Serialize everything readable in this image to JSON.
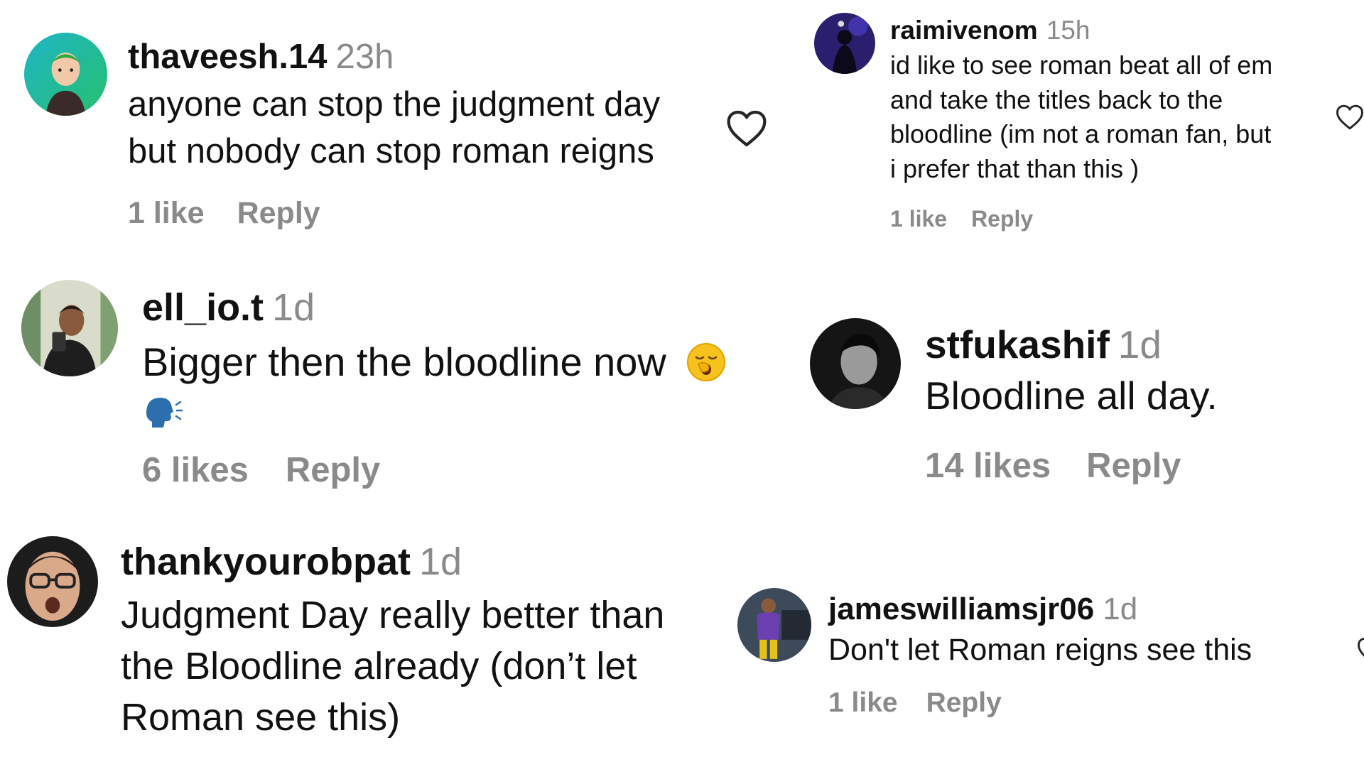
{
  "comments": [
    {
      "username": "thaveesh.14",
      "time": "23h",
      "text_lines": [
        "anyone can stop the judgment day",
        "but nobody can stop roman reigns"
      ],
      "likes": "1 like",
      "reply": "Reply",
      "avatar_icon": "cartoon-avatar-green-cap"
    },
    {
      "username": "raimivenom",
      "time": "15h",
      "text_lines": [
        "id like to see roman beat all of em",
        "and take the titles back to the",
        "bloodline (im not a roman fan, but",
        "i prefer that than this )"
      ],
      "likes": "1 like",
      "reply": "Reply",
      "avatar_icon": "dark-purple-figure-avatar"
    },
    {
      "username": "ell_io.t",
      "time": "1d",
      "text": "Bigger then the bloodline now",
      "emoji_inline": "yawning-face-emoji",
      "emoji_below": "speaking-head-emoji",
      "likes": "6 likes",
      "reply": "Reply",
      "avatar_icon": "selfie-photo-avatar"
    },
    {
      "username": "stfukashif",
      "time": "1d",
      "text": "Bloodline all day.",
      "likes": "14 likes",
      "reply": "Reply",
      "avatar_icon": "black-and-white-portrait-avatar"
    },
    {
      "username": "thankyourobpat",
      "time": "1d",
      "text_lines": [
        "Judgment Day really better than",
        "the Bloodline already (don’t let",
        "Roman see this)"
      ],
      "avatar_icon": "glasses-face-avatar"
    },
    {
      "username": "jameswilliamsjr06",
      "time": "1d",
      "text": "Don't let Roman reigns see this",
      "likes": "1 like",
      "reply": "Reply",
      "avatar_icon": "purple-outfit-person-avatar"
    }
  ],
  "colors": {
    "text": "#111111",
    "muted": "#8a8a8a",
    "heart_outline": "#262626"
  }
}
